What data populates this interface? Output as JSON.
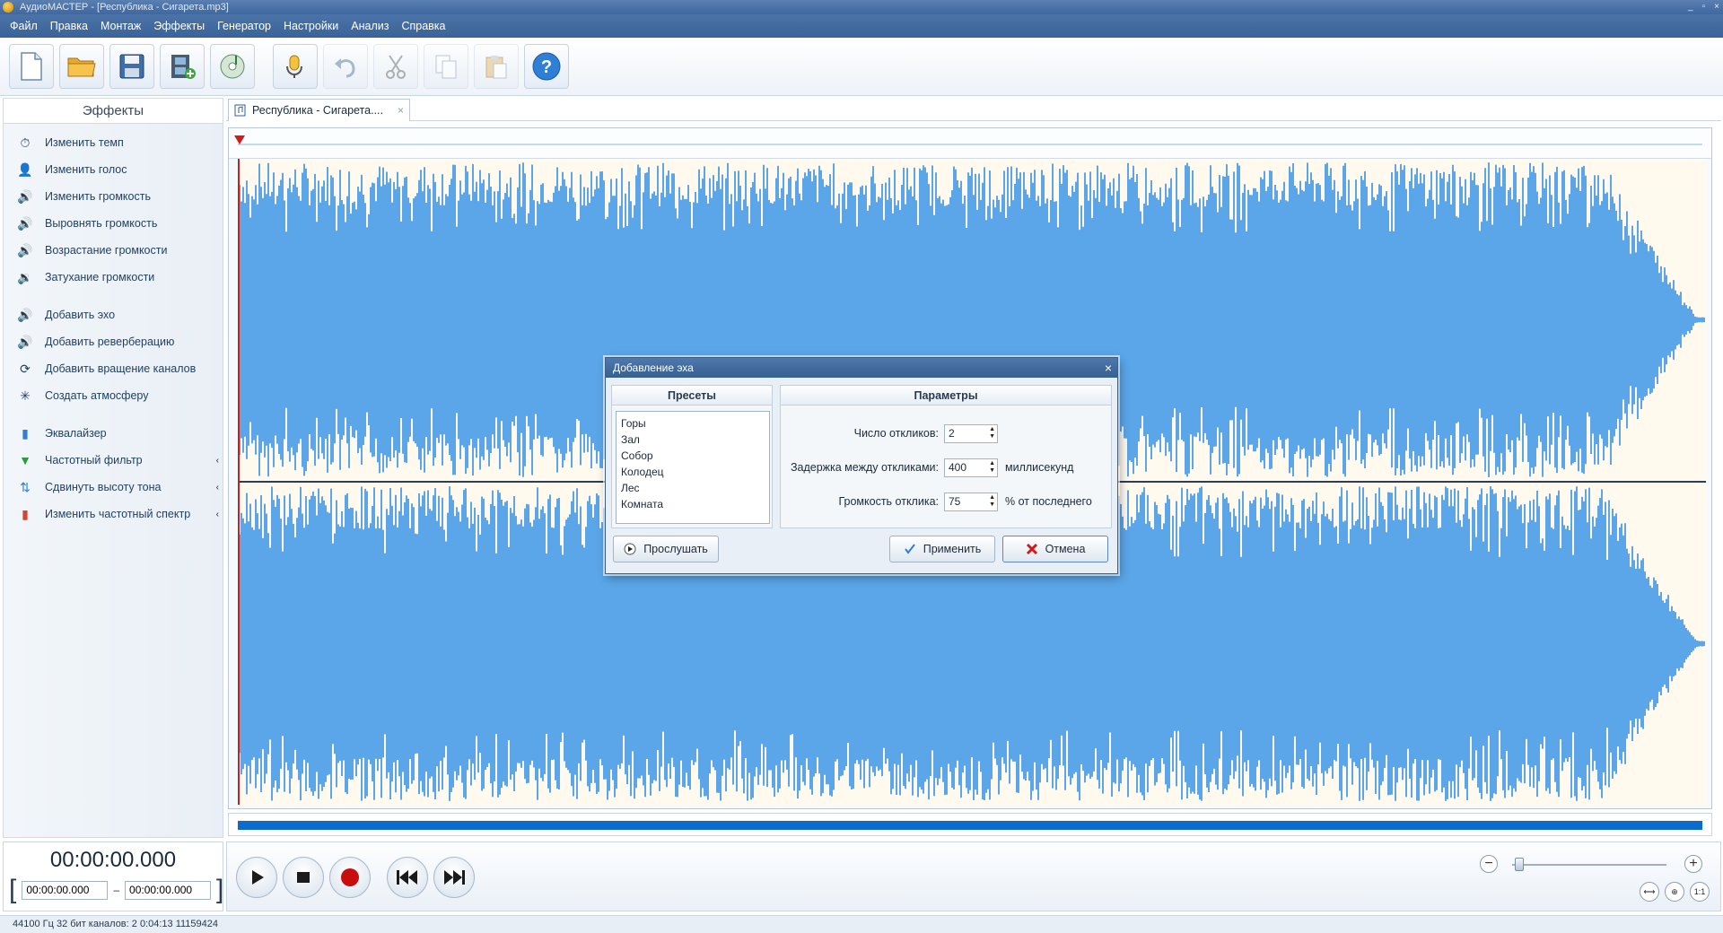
{
  "window": {
    "title": "АудиоМАСТЕР - [Республика - Сигарета.mp3]",
    "controls": [
      "_",
      "▫",
      "×"
    ]
  },
  "menu": [
    "Файл",
    "Правка",
    "Монтаж",
    "Эффекты",
    "Генератор",
    "Настройки",
    "Анализ",
    "Справка"
  ],
  "toolbar": {
    "buttons": [
      {
        "name": "new-file-icon",
        "disabled": false
      },
      {
        "name": "open-folder-icon",
        "disabled": false
      },
      {
        "name": "save-icon",
        "disabled": false
      },
      {
        "name": "add-video-icon",
        "disabled": false
      },
      {
        "name": "cd-music-icon",
        "disabled": false
      },
      {
        "name": "record-voice-icon",
        "disabled": false
      },
      {
        "name": "undo-icon",
        "disabled": true
      },
      {
        "name": "cut-icon",
        "disabled": true
      },
      {
        "name": "copy-icon",
        "disabled": true
      },
      {
        "name": "paste-icon",
        "disabled": true
      },
      {
        "name": "help-icon",
        "disabled": false
      }
    ],
    "help_glyph": "?"
  },
  "effects": {
    "header": "Эффекты",
    "groups": [
      [
        {
          "label": "Изменить темп",
          "icon": "⏱"
        },
        {
          "label": "Изменить голос",
          "icon": "👤"
        },
        {
          "label": "Изменить громкость",
          "icon": "🔊"
        },
        {
          "label": "Выровнять громкость",
          "icon": "🔊"
        },
        {
          "label": "Возрастание громкости",
          "icon": "🔊"
        },
        {
          "label": "Затухание громкости",
          "icon": "🔉"
        }
      ],
      [
        {
          "label": "Добавить эхо",
          "icon": "🔊"
        },
        {
          "label": "Добавить реверберацию",
          "icon": "🔊"
        },
        {
          "label": "Добавить вращение каналов",
          "icon": "⟳"
        },
        {
          "label": "Создать атмосферу",
          "icon": "✳"
        }
      ],
      [
        {
          "label": "Эквалайзер",
          "icon": "▮"
        },
        {
          "label": "Частотный фильтр",
          "icon": "▼",
          "arrow": "‹"
        },
        {
          "label": "Сдвинуть высоту тона",
          "icon": "⇅",
          "arrow": "‹"
        },
        {
          "label": "Изменить частотный спектр",
          "icon": "▮",
          "arrow": "‹"
        }
      ]
    ]
  },
  "doc_tab": {
    "label": "Республика - Сигарета....",
    "close": "×"
  },
  "transport": {
    "current_time": "00:00:00.000",
    "range_start": "00:00:00.000",
    "range_sep": "–",
    "range_end": "00:00:00.000",
    "bracket_open": "[",
    "bracket_close": "]",
    "zoom_minus": "−",
    "zoom_plus": "+",
    "zoom_level": 0.02,
    "mini_buttons": [
      "⟷",
      "⊕",
      "1:1"
    ]
  },
  "status": {
    "text": "44100 Гц  32 бит  каналов: 2   0:04:13 11159424"
  },
  "dialog": {
    "title": "Добавление эха",
    "close": "×",
    "presets_header": "Пресеты",
    "presets": [
      "Горы",
      "Зал",
      "Собор",
      "Колодец",
      "Лес",
      "Комната"
    ],
    "params_header": "Параметры",
    "params": [
      {
        "label": "Число откликов:",
        "value": "2",
        "unit": ""
      },
      {
        "label": "Задержка между откликами:",
        "value": "400",
        "unit": "миллисекунд"
      },
      {
        "label": "Громкость отклика:",
        "value": "75",
        "unit": "% от последнего"
      }
    ],
    "preview_label": "Прослушать",
    "apply_label": "Применить",
    "cancel_label": "Отмена"
  },
  "colors": {
    "waveform": "#5aa6e8",
    "wave_bg": "#fff9ee",
    "accent": "#0a6ccc",
    "title_bar": "#3f68a1",
    "playhead": "#d11a1a"
  }
}
